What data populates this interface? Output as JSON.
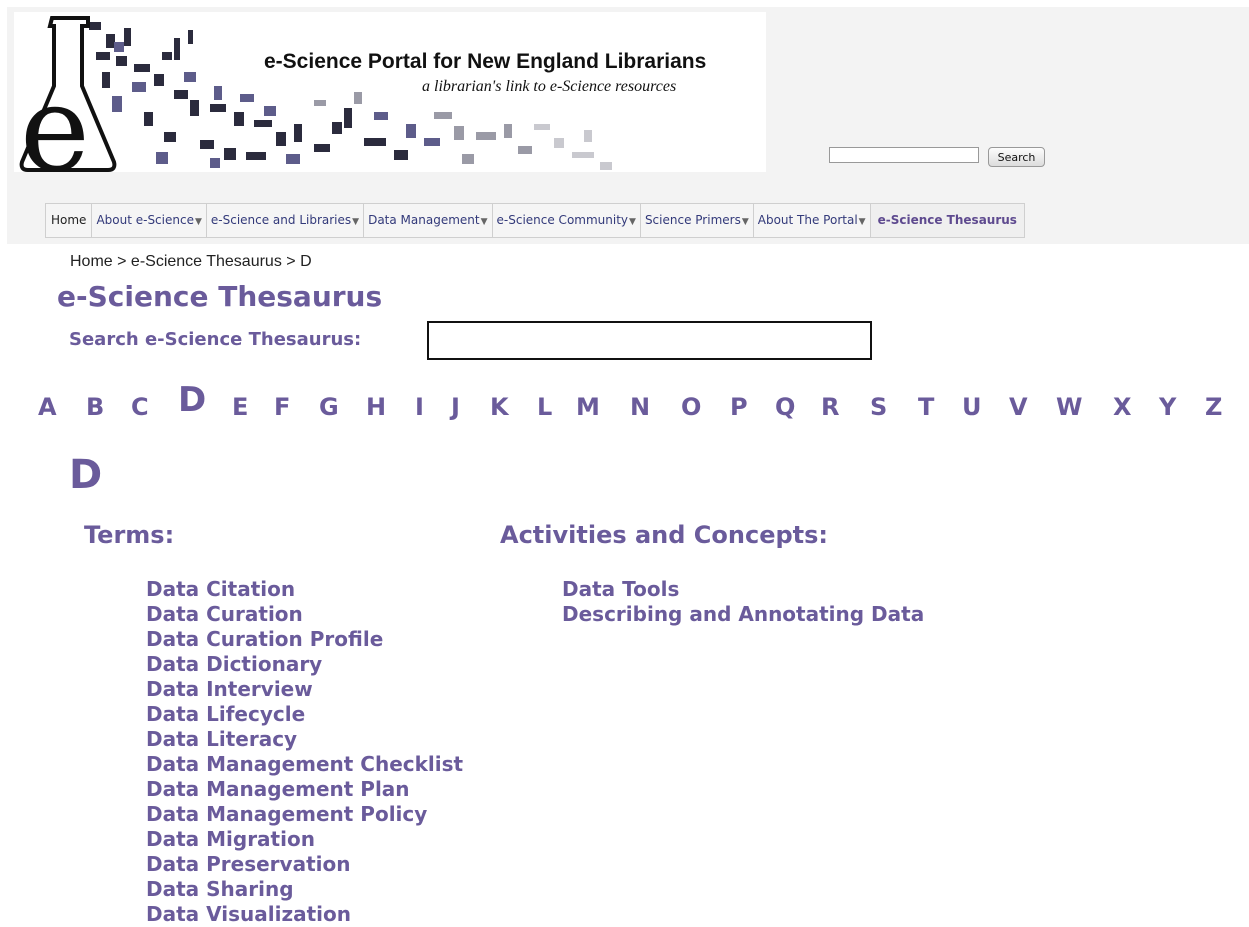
{
  "banner": {
    "title": "e-Science Portal for New England Librarians",
    "tagline": "a librarian's link to e-Science resources"
  },
  "top_search": {
    "button_label": "Search",
    "value": ""
  },
  "nav": {
    "items": [
      {
        "label": "Home",
        "dropdown": false
      },
      {
        "label": "About e-Science",
        "dropdown": true
      },
      {
        "label": "e-Science and Libraries",
        "dropdown": true
      },
      {
        "label": "Data Management",
        "dropdown": true
      },
      {
        "label": "e-Science Community",
        "dropdown": true
      },
      {
        "label": "Science Primers",
        "dropdown": true
      },
      {
        "label": "About The Portal",
        "dropdown": true
      },
      {
        "label": "e-Science  Thesaurus",
        "dropdown": false,
        "active": true
      }
    ]
  },
  "breadcrumb": {
    "home": "Home",
    "sep1": " > ",
    "section": "e-Science Thesaurus",
    "sep2": " > ",
    "current": "D"
  },
  "page": {
    "title": "e-Science Thesaurus",
    "search_label": "Search e-Science Thesaurus:",
    "search_value": ""
  },
  "letters": [
    "A",
    "B",
    "C",
    "D",
    "E",
    "F",
    "G",
    "H",
    "I",
    "J",
    "K",
    "L",
    "M",
    "N",
    "O",
    "P",
    "Q",
    "R",
    "S",
    "T",
    "U",
    "V",
    "W",
    "X",
    "Y",
    "Z"
  ],
  "current_letter": "D",
  "section_letter": "D",
  "terms": {
    "heading": "Terms:",
    "items": [
      "Data Citation",
      "Data Curation",
      "Data Curation Profile",
      "Data Dictionary",
      "Data Interview",
      "Data Lifecycle",
      "Data Literacy",
      "Data Management Checklist",
      "Data Management Plan",
      "Data Management Policy",
      "Data Migration",
      "Data Preservation",
      "Data Sharing",
      "Data Visualization"
    ]
  },
  "activities": {
    "heading": "Activities and Concepts:",
    "items": [
      "Data Tools",
      "Describing and Annotating Data"
    ]
  },
  "colors": {
    "accent": "#6a5b9b",
    "nav_text": "#333a7a"
  }
}
